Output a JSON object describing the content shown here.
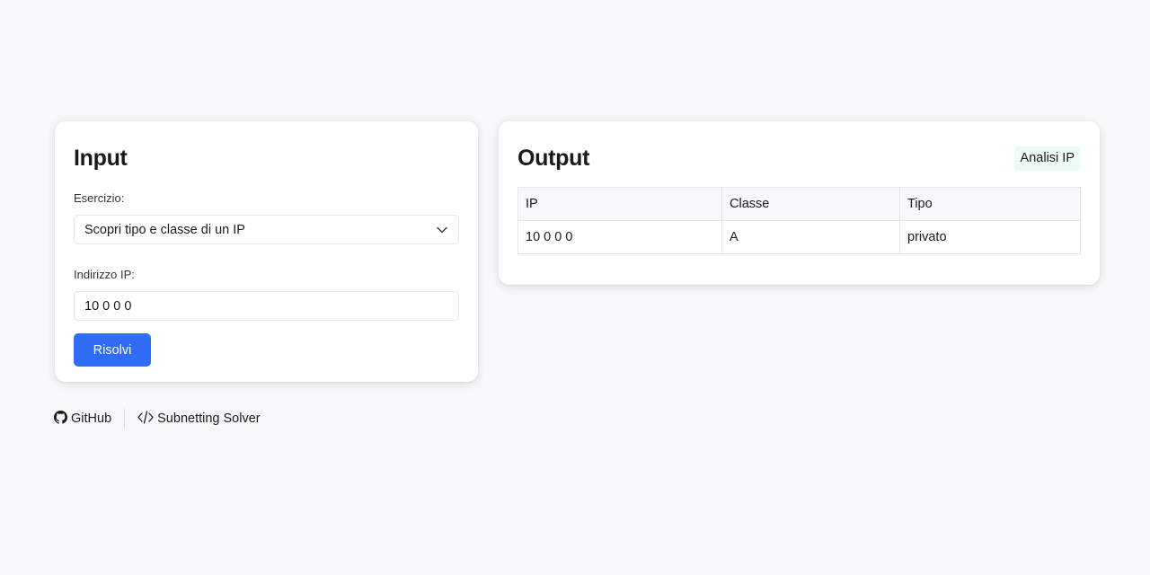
{
  "input_card": {
    "title": "Input",
    "exercise_label": "Esercizio:",
    "exercise_value": "Scopri tipo e classe di un IP",
    "ip_label": "Indirizzo IP:",
    "ip_value": "10 0 0 0",
    "solve_label": "Risolvi"
  },
  "output_card": {
    "title": "Output",
    "badge": "Analisi IP",
    "columns": [
      "IP",
      "Classe",
      "Tipo"
    ],
    "rows": [
      [
        "10 0 0 0",
        "A",
        "privato"
      ]
    ]
  },
  "footer": {
    "github_label": "GitHub",
    "project_label": "Subnetting Solver"
  },
  "colors": {
    "accent": "#2f6df6",
    "badge_bg": "#eefaf5",
    "page_bg": "#f7f8fa"
  }
}
